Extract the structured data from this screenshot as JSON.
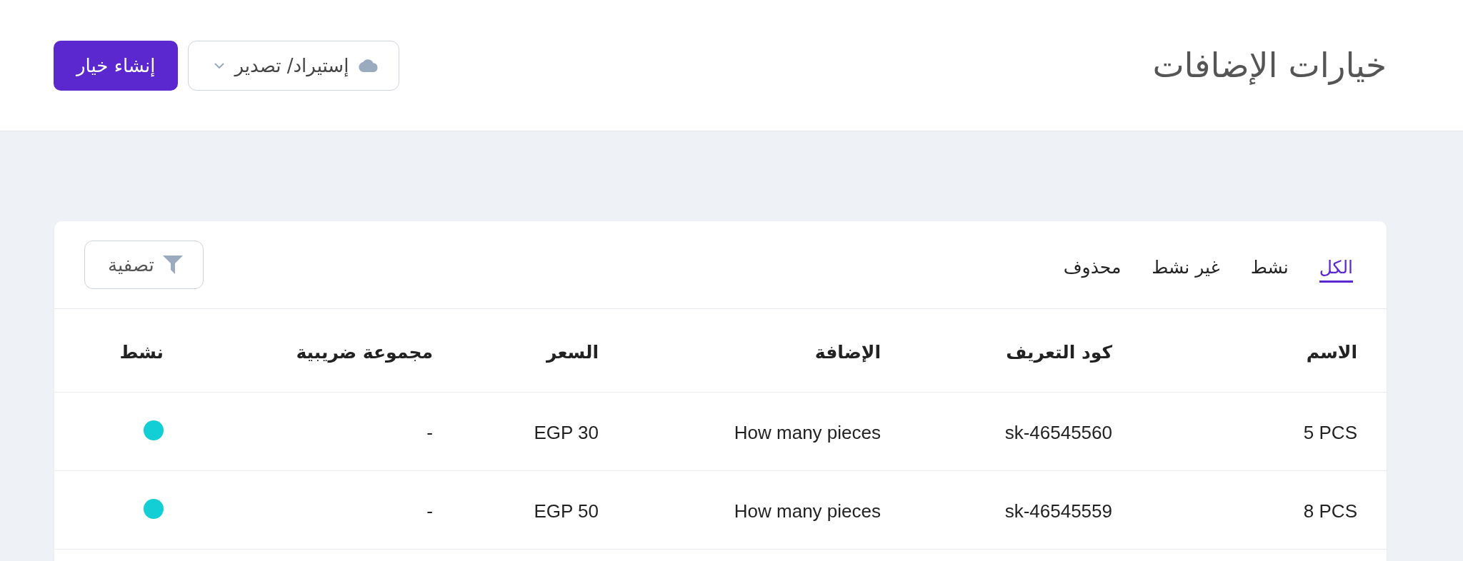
{
  "page": {
    "title": "خيارات الإضافات"
  },
  "actions": {
    "import_export": {
      "label": "إستيراد/ تصدير"
    },
    "create": {
      "label": "إنشاء خيار"
    }
  },
  "tabs": [
    {
      "label": "الكل",
      "selected": true
    },
    {
      "label": "نشط",
      "selected": false
    },
    {
      "label": "غير نشط",
      "selected": false
    },
    {
      "label": "محذوف",
      "selected": false
    }
  ],
  "filter": {
    "label": "تصفية"
  },
  "table": {
    "columns": [
      "الاسم",
      "كود التعريف",
      "الإضافة",
      "السعر",
      "مجموعة ضريبية",
      "نشط"
    ],
    "rows": [
      {
        "cells": [
          "5 PCS",
          "sk-46545560",
          "How many pieces",
          "EGP 30",
          "-"
        ],
        "active": true
      },
      {
        "cells": [
          "8 PCS",
          "sk-46545559",
          "How many pieces",
          "EGP 50",
          "-"
        ],
        "active": true
      }
    ]
  }
}
